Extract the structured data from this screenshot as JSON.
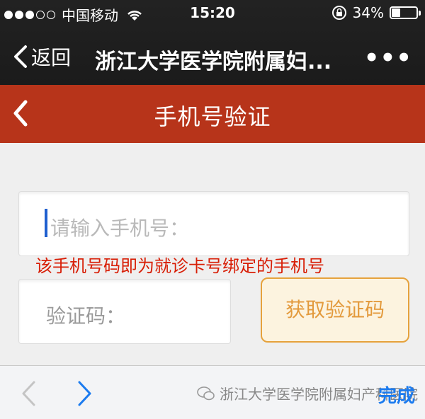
{
  "status_bar": {
    "carrier": "中国移动",
    "time": "15:20",
    "battery_text": "34%",
    "battery_level": 0.34,
    "signal_bars_filled": 3,
    "signal_bars_total": 5
  },
  "nav": {
    "back_label": "返回",
    "title": "浙江大学医学院附属妇...",
    "more": "•••"
  },
  "page": {
    "title": "手机号验证"
  },
  "form": {
    "phone_placeholder": "请输入手机号：",
    "hint": "该手机号码即为就诊卡号绑定的手机号",
    "code_placeholder": "验证码：",
    "get_code_label": "获取验证码"
  },
  "toolbar": {
    "done_label": "完成",
    "watermark": "浙江大学医学院附属妇产科医院"
  },
  "colors": {
    "header_red": "#b7341a",
    "hint_red": "#d81e06",
    "button_orange": "#e39a3c",
    "link_blue": "#1b7bef"
  }
}
